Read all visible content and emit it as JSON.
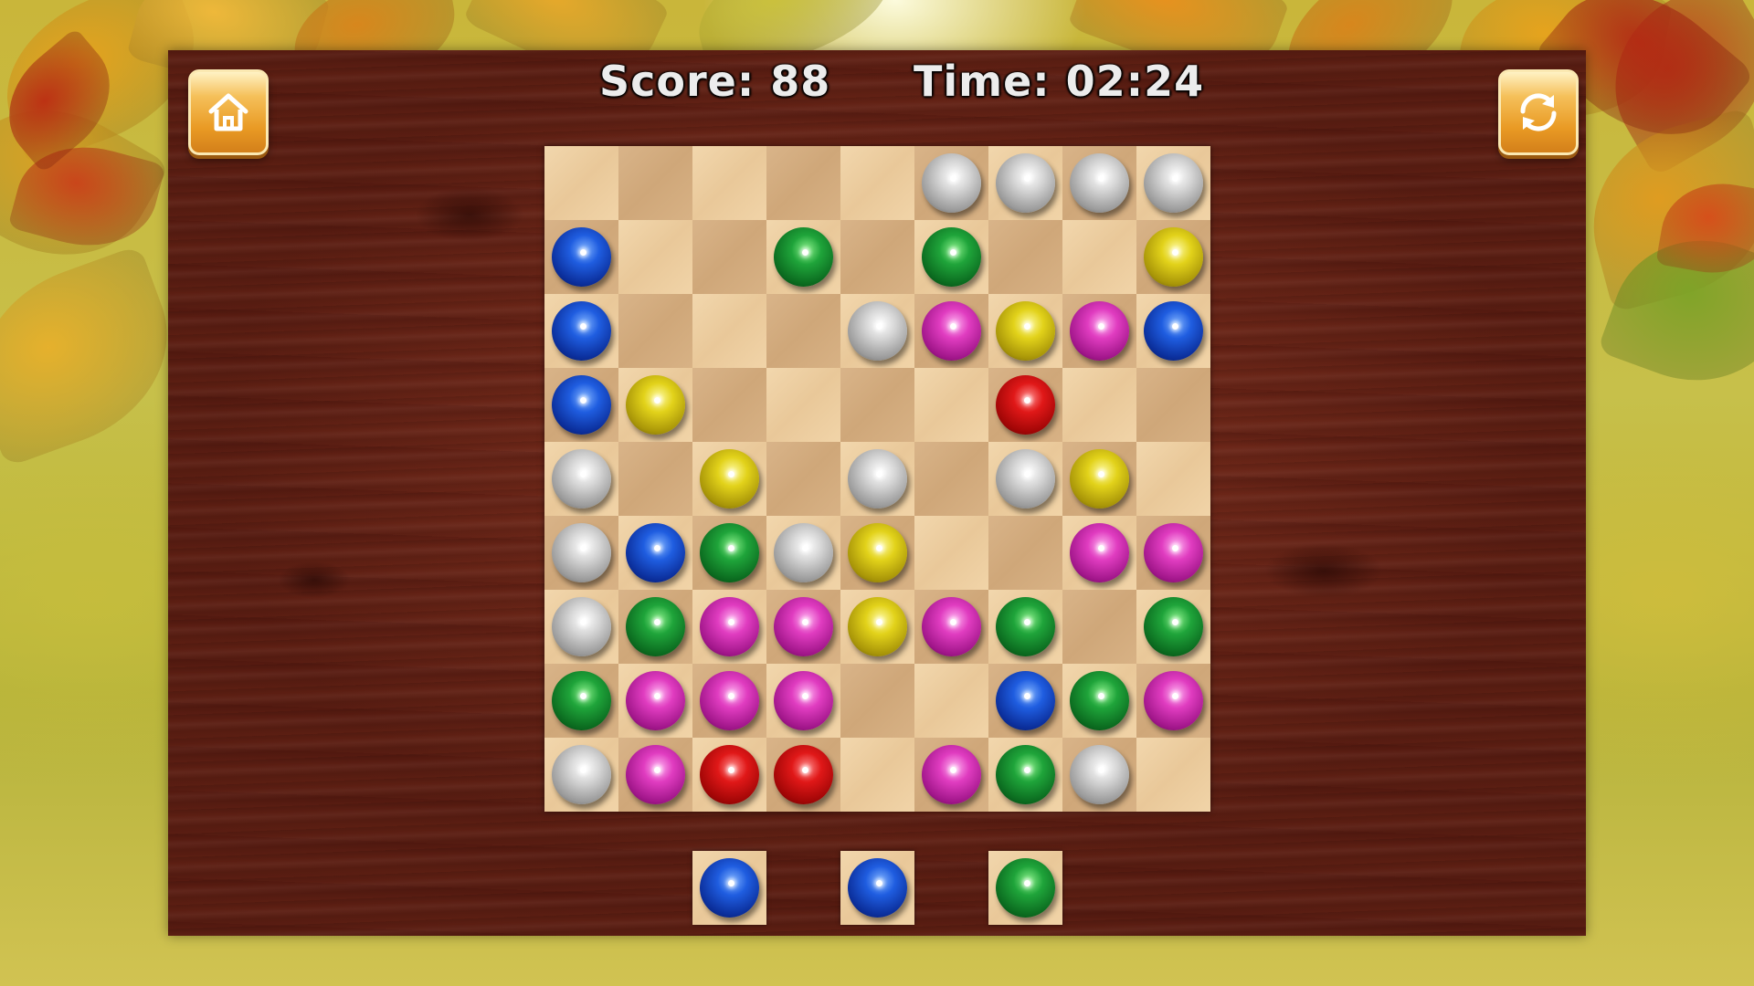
{
  "hud": {
    "score": "Score: 88",
    "time": "Time: 02:24"
  },
  "buttons": {
    "home_icon": "home-icon",
    "restart_icon": "restart-icon"
  },
  "colors": {
    "blue": "#1f5de0",
    "green": "#1fa43a",
    "yellow": "#e2d21a",
    "pink": "#e03cc0",
    "red": "#e01818",
    "silver": "#d6d6d6"
  },
  "board": {
    "rows": 9,
    "cols": 9,
    "cells": [
      [
        "",
        "",
        "",
        "",
        "",
        "silver",
        "silver",
        "silver",
        "silver"
      ],
      [
        "blue",
        "",
        "",
        "green",
        "",
        "green",
        "",
        "",
        "yellow"
      ],
      [
        "blue",
        "",
        "",
        "",
        "silver",
        "pink",
        "yellow",
        "pink",
        "blue"
      ],
      [
        "blue",
        "yellow",
        "",
        "",
        "",
        "",
        "red",
        "",
        ""
      ],
      [
        "silver",
        "",
        "yellow",
        "",
        "silver",
        "",
        "silver",
        "yellow",
        ""
      ],
      [
        "silver",
        "blue",
        "green",
        "silver",
        "yellow",
        "",
        "",
        "pink",
        "pink"
      ],
      [
        "silver",
        "green",
        "pink",
        "pink",
        "yellow",
        "pink",
        "green",
        "",
        "green"
      ],
      [
        "green",
        "pink",
        "pink",
        "pink",
        "",
        "",
        "blue",
        "green",
        "pink"
      ],
      [
        "silver",
        "pink",
        "red",
        "red",
        "",
        "pink",
        "green",
        "silver",
        ""
      ]
    ]
  },
  "next_balls": [
    "blue",
    "blue",
    "green"
  ]
}
